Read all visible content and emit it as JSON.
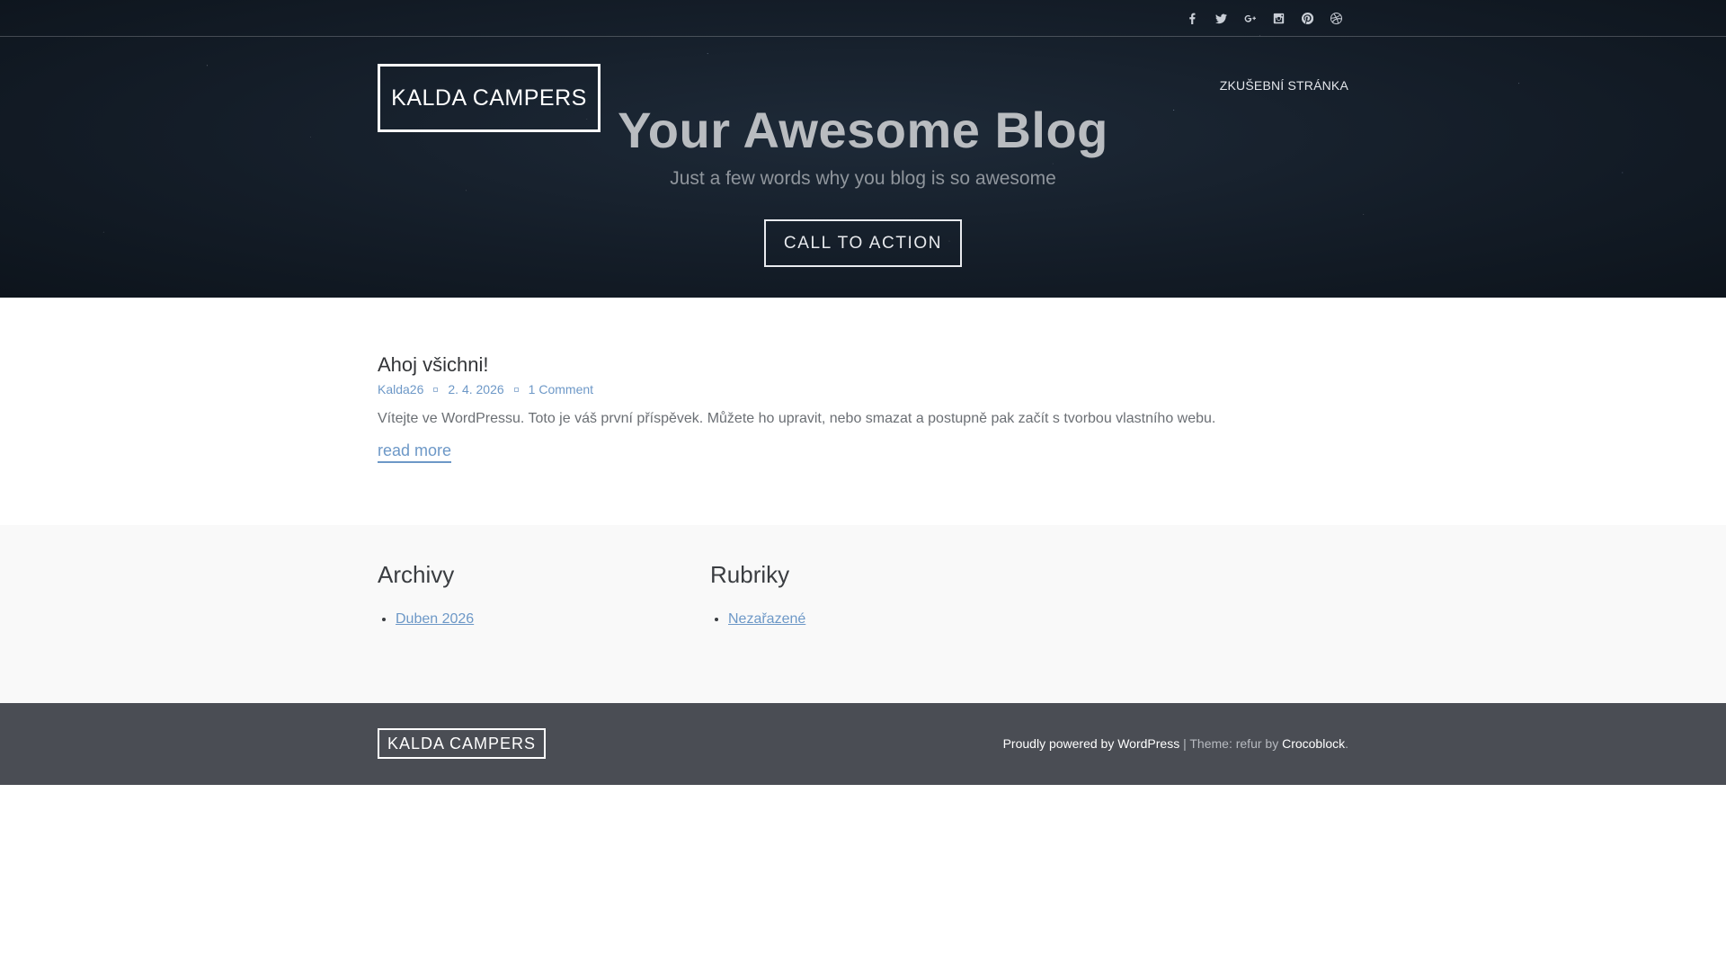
{
  "header": {
    "social_icons": [
      "facebook-icon",
      "twitter-icon",
      "google-plus-icon",
      "instagram-icon",
      "pinterest-icon",
      "dribbble-icon"
    ],
    "logo": "KALDA CAMPERS",
    "nav": [
      "ZKUŠEBNÍ STRÁNKA"
    ],
    "title": "Your Awesome Blog",
    "tagline": "Just a few words why you blog is so awesome",
    "cta": "CALL TO ACTION"
  },
  "post": {
    "title": "Ahoj všichni!",
    "author": "Kalda26",
    "date": "2. 4. 2026",
    "comments": "1 Comment",
    "excerpt": "Vítejte ve WordPressu. Toto je váš první příspěvek. Můžete ho upravit, nebo smazat a postupně pak začít s tvorbou vlastního webu.",
    "read_more": "read more"
  },
  "widgets": [
    {
      "title": "Archivy",
      "items": [
        "Duben 2026"
      ]
    },
    {
      "title": "Rubriky",
      "items": [
        "Nezařazené"
      ]
    }
  ],
  "footer": {
    "logo": "KALDA CAMPERS",
    "powered": "Proudly powered by WordPress",
    "separator": " | ",
    "theme_prefix": "Theme: refur by ",
    "theme_author": "Crocoblock",
    "period": "."
  },
  "colors": {
    "link": "#6d98c7",
    "footer_bg": "#4a4d54",
    "widgets_bg": "#f9f9f9",
    "hero_bg": "#141d28"
  }
}
